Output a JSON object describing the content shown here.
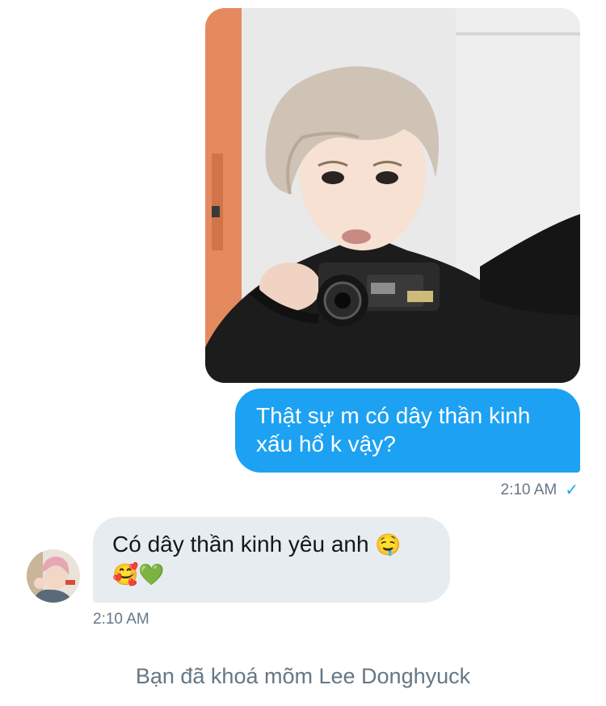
{
  "conversation": {
    "sent_image": {
      "icon": "photo-of-person-with-camcorder"
    },
    "sent_message": {
      "text": "Thật sự m có dây thần kinh xấu hổ k vậy?",
      "time": "2:10 AM",
      "status_icon": "✓",
      "bubble_color": "#1da1f2"
    },
    "received_message": {
      "text": "Có dây thần kinh yêu anh",
      "emoji_line1": "🤤",
      "emoji_line2": "🥰💚",
      "time": "2:10 AM",
      "bubble_color": "#e6ecf0"
    },
    "system_notice": "Bạn đã khoá mõm Lee Donghyuck"
  }
}
